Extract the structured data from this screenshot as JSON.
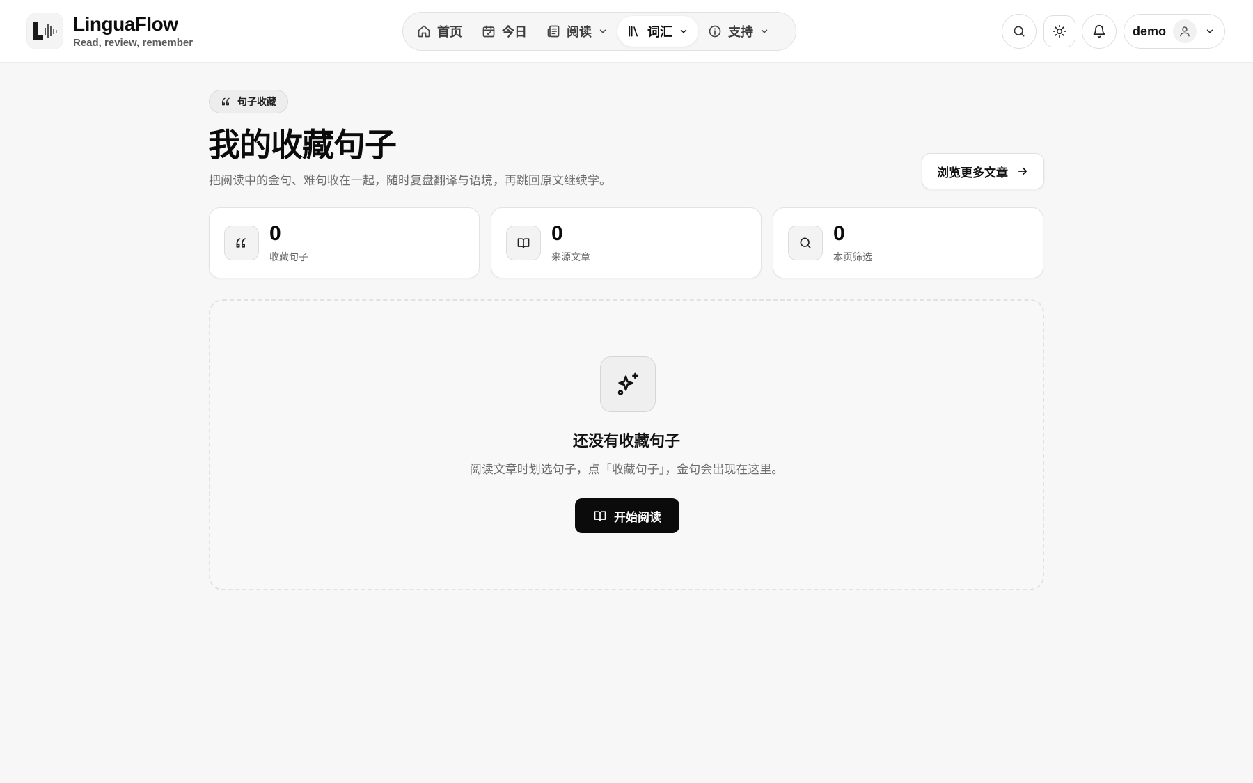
{
  "app": {
    "name": "LinguaFlow",
    "tagline": "Read, review, remember",
    "logo_icon": "waveform-logo-icon"
  },
  "nav": {
    "items": [
      {
        "label": "首页",
        "icon": "home-icon",
        "has_dropdown": false,
        "active": false
      },
      {
        "label": "今日",
        "icon": "calendar-icon",
        "has_dropdown": false,
        "active": false
      },
      {
        "label": "阅读",
        "icon": "newspaper-icon",
        "has_dropdown": true,
        "active": false
      },
      {
        "label": "词汇",
        "icon": "library-icon",
        "has_dropdown": true,
        "active": true
      },
      {
        "label": "支持",
        "icon": "info-icon",
        "has_dropdown": true,
        "active": false
      }
    ]
  },
  "header_actions": {
    "search_icon": "search-icon",
    "theme_icon": "sun-icon",
    "notifications_icon": "bell-icon",
    "user_name": "demo",
    "user_icon": "user-icon"
  },
  "hero": {
    "badge_label": "句子收藏",
    "title": "我的收藏句子",
    "subtitle": "把阅读中的金句、难句收在一起，随时复盘翻译与语境，再跳回原文继续学。",
    "browse_button": "浏览更多文章"
  },
  "stats": [
    {
      "value": "0",
      "label": "收藏句子",
      "icon": "quote-icon"
    },
    {
      "value": "0",
      "label": "来源文章",
      "icon": "book-icon"
    },
    {
      "value": "0",
      "label": "本页筛选",
      "icon": "search-icon"
    }
  ],
  "empty_state": {
    "icon": "sparkles-icon",
    "title": "还没有收藏句子",
    "description": "阅读文章时划选句子，点「收藏句子」，金句会出现在这里。",
    "button_label": "开始阅读"
  },
  "colors": {
    "background": "#f7f7f7",
    "primary_button": "#0b0b0b",
    "card_border": "#e3e3e3"
  }
}
